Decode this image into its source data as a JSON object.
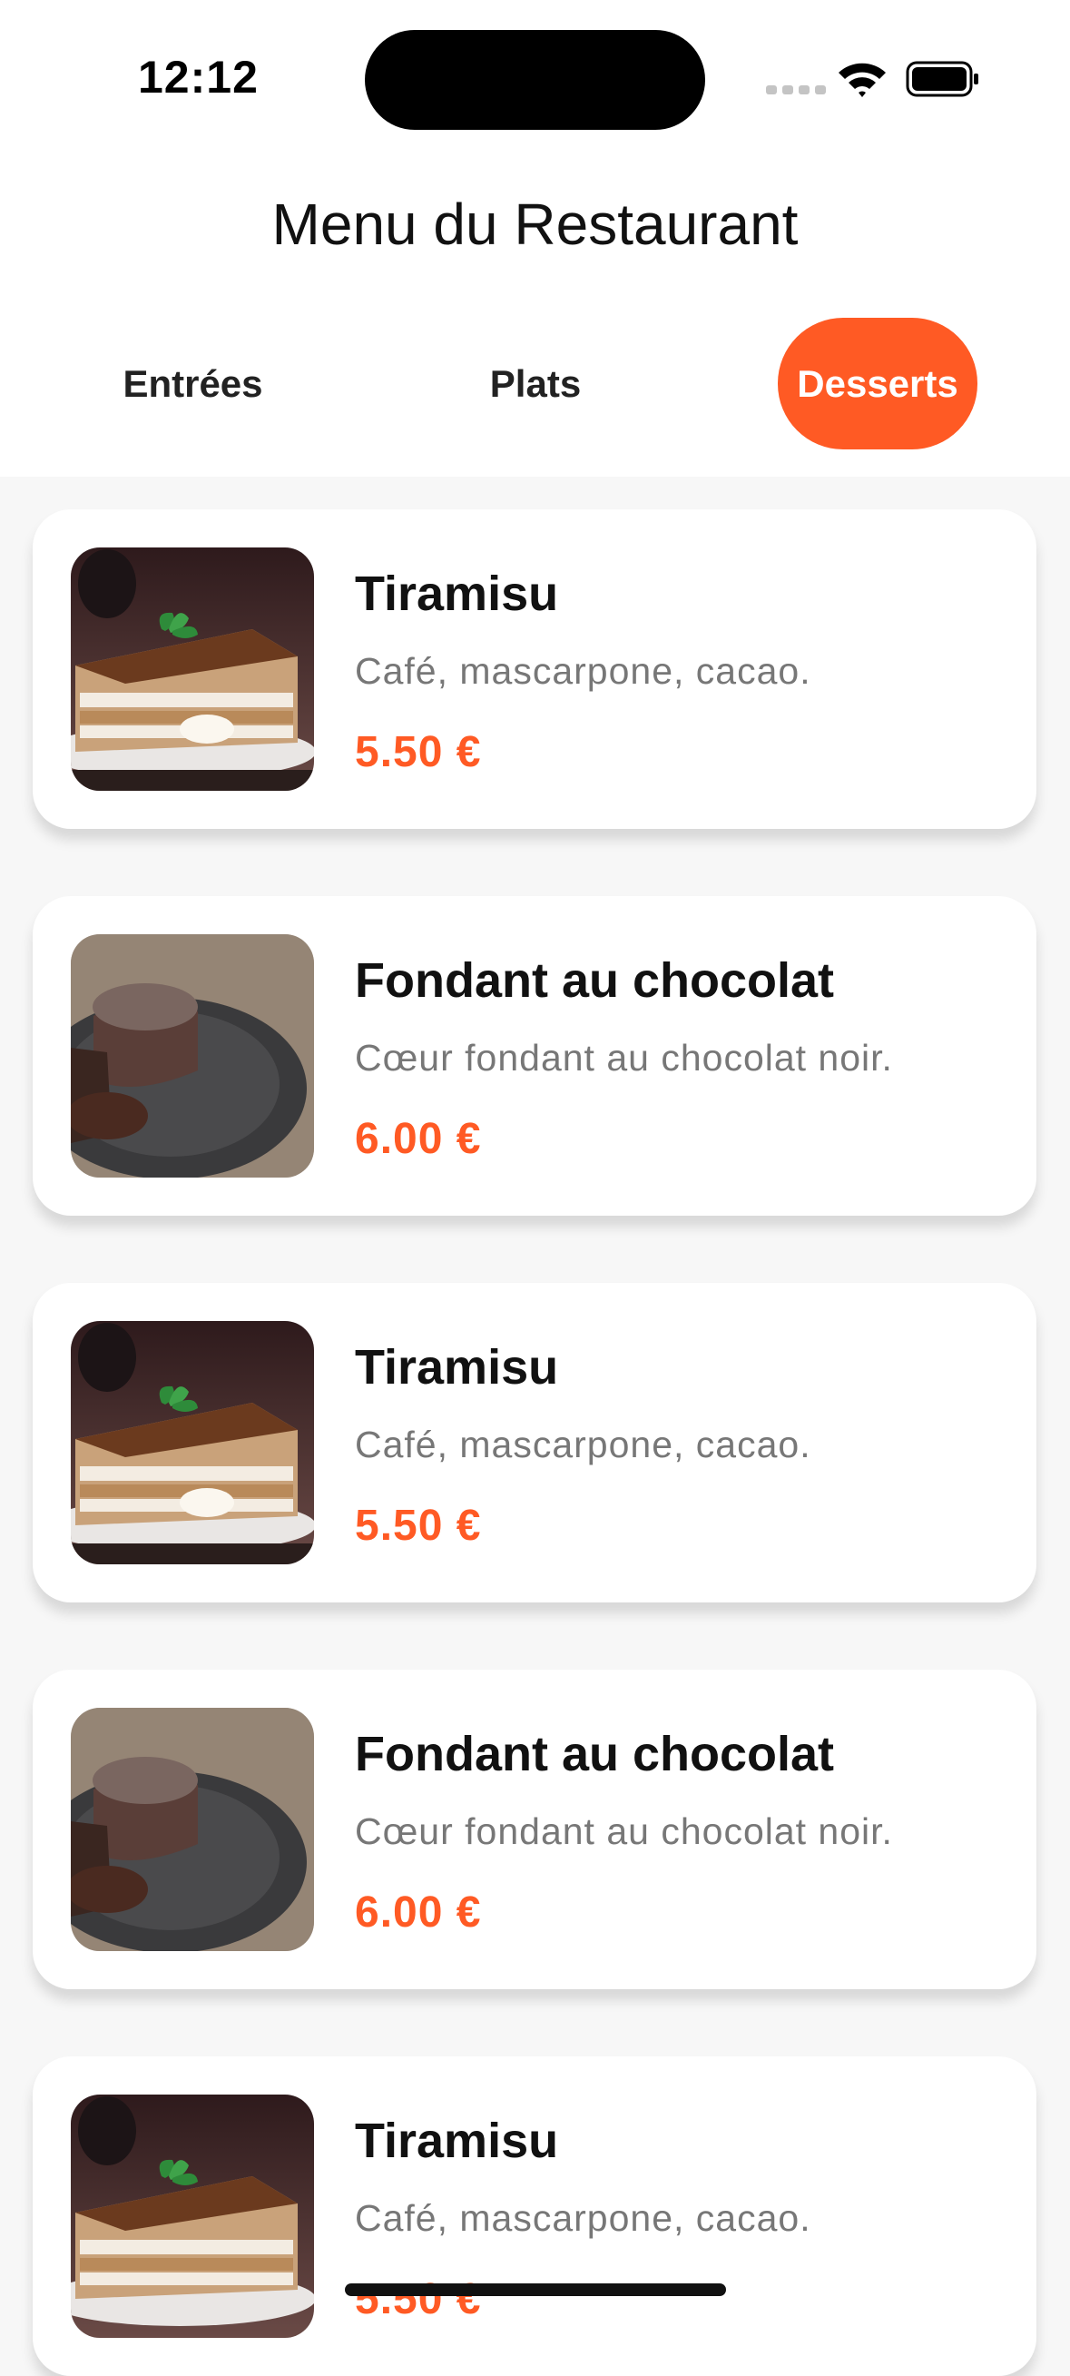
{
  "status_bar": {
    "time": "12:12"
  },
  "header": {
    "title": "Menu du Restaurant"
  },
  "tabs": [
    {
      "label": "Entrées",
      "active": false
    },
    {
      "label": "Plats",
      "active": false
    },
    {
      "label": "Desserts",
      "active": true
    }
  ],
  "items": [
    {
      "name": "Tiramisu",
      "description": "Café, mascarpone, cacao.",
      "price": "5.50 €",
      "image": "tiramisu"
    },
    {
      "name": "Fondant au chocolat",
      "description": "Cœur fondant au chocolat noir.",
      "price": "6.00 €",
      "image": "fondant"
    },
    {
      "name": "Tiramisu",
      "description": "Café, mascarpone, cacao.",
      "price": "5.50 €",
      "image": "tiramisu"
    },
    {
      "name": "Fondant au chocolat",
      "description": "Cœur fondant au chocolat noir.",
      "price": "6.00 €",
      "image": "fondant"
    },
    {
      "name": "Tiramisu",
      "description": "Café, mascarpone, cacao.",
      "price": "5.50 €",
      "image": "tiramisu"
    }
  ],
  "colors": {
    "accent": "#ff5a24",
    "background": "#f7f7f7"
  }
}
